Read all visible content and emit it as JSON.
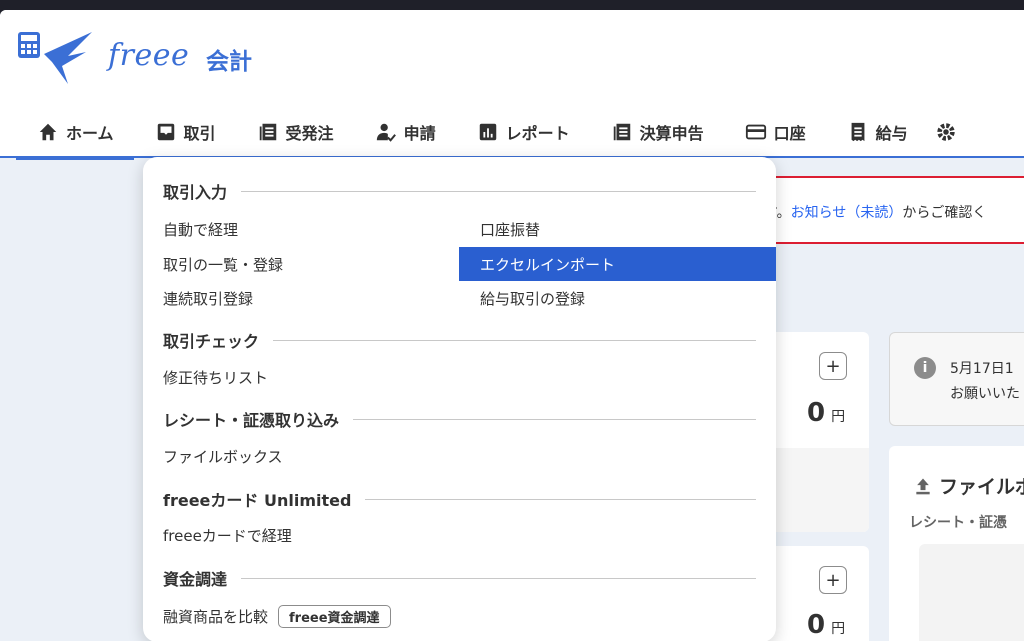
{
  "brand": {
    "name": "freee",
    "product": "会計"
  },
  "nav": [
    {
      "label": "ホーム",
      "icon": "home-icon"
    },
    {
      "label": "取引",
      "icon": "inbox-icon"
    },
    {
      "label": "受発注",
      "icon": "document-list-icon"
    },
    {
      "label": "申請",
      "icon": "user-check-icon"
    },
    {
      "label": "レポート",
      "icon": "report-chart-icon"
    },
    {
      "label": "決算申告",
      "icon": "document-list-icon"
    },
    {
      "label": "口座",
      "icon": "credit-card-icon"
    },
    {
      "label": "給与",
      "icon": "receipt-icon"
    }
  ],
  "notice": {
    "prefix": "す。",
    "link": "お知らせ（未読）",
    "suffix": "からご確認く"
  },
  "cards": {
    "amount1": "0",
    "amount2": "0",
    "currency": "円",
    "plus": "+"
  },
  "info": {
    "icon": "i",
    "line1": "5月17日1",
    "line2": "お願いいた"
  },
  "file_card": {
    "title": "ファイルボ",
    "subtitle": "レシート・証憑"
  },
  "dropdown": {
    "sections": [
      {
        "title": "取引入力"
      },
      {
        "title": "取引チェック"
      },
      {
        "title": "レシート・証憑取り込み"
      },
      {
        "title": "freeeカード Unlimited"
      },
      {
        "title": "資金調達"
      }
    ],
    "items": {
      "auto": "自動で経理",
      "list": "取引の一覧・登録",
      "continuous": "連続取引登録",
      "transfer": "口座振替",
      "excel": "エクセルインポート",
      "payroll": "給与取引の登録",
      "fix": "修正待ちリスト",
      "filebox": "ファイルボックス",
      "card": "freeeカードで経理",
      "loan": "融資商品を比較",
      "loan_tag": "freee資金調達"
    }
  },
  "colors": {
    "accent": "#3b6fd5",
    "highlight": "#2a5fd0",
    "alert": "#dc1e32"
  }
}
